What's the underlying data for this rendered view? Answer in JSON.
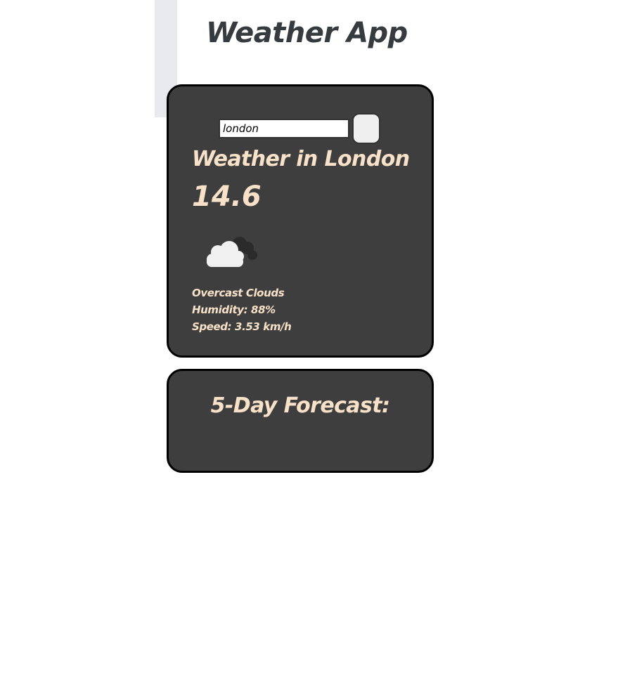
{
  "app": {
    "title": "Weather App"
  },
  "search": {
    "value": "london",
    "placeholder": ""
  },
  "current": {
    "heading": "Weather in London",
    "temperature": "14.6",
    "icon": "cloud-icon",
    "description": "Overcast Clouds",
    "humidity": "Humidity: 88%",
    "speed": "Speed: 3.53 km/h"
  },
  "forecast": {
    "title": "5-Day Forecast:"
  },
  "colors": {
    "card_background": "#3e3e3e",
    "card_border": "#000000",
    "text_accent": "#f7e1c8",
    "title_text": "#363b40"
  }
}
